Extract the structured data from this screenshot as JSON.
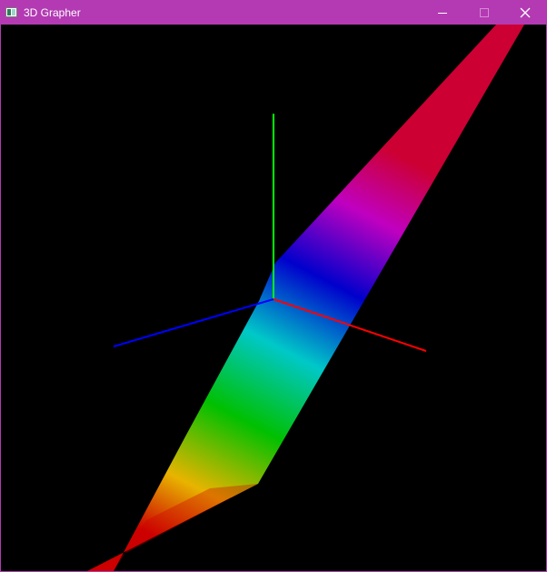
{
  "window": {
    "title": "3D Grapher",
    "accent_color": "#b33ab3",
    "icons": {
      "app": "app-window-icon",
      "minimize": "minimize-icon",
      "maximize": "maximize-icon",
      "close": "close-icon"
    }
  },
  "scene": {
    "background_color": "#000000",
    "axes": {
      "x_color": "#ff0000",
      "y_color": "#00ff00",
      "z_color": "#0000ff"
    },
    "surface_gradient_colors": [
      "#cc0000",
      "#e8b400",
      "#00c000",
      "#00c0c0",
      "#0000cc",
      "#c000c0",
      "#cc0033"
    ]
  }
}
